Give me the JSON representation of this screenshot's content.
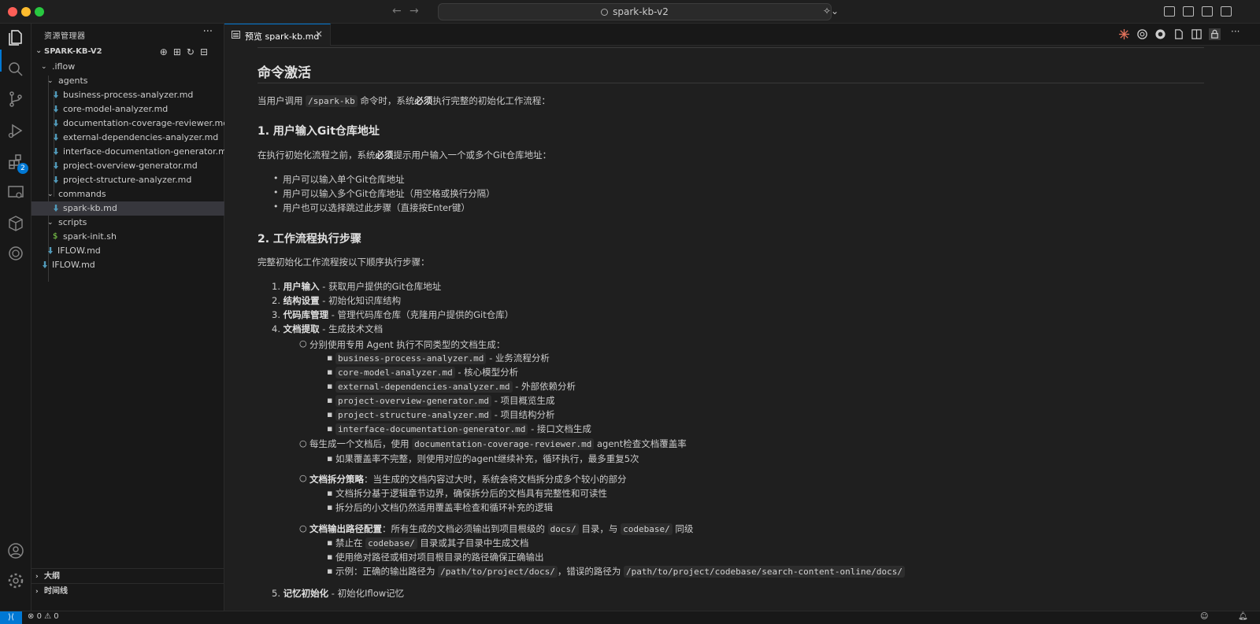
{
  "window": {
    "command_center": "spark-kb-v2"
  },
  "sidebar": {
    "title": "资源管理器",
    "root": "SPARK-KB-V2",
    "tree": [
      {
        "label": ".iflow",
        "type": "folder"
      },
      {
        "label": "agents",
        "type": "folder"
      },
      {
        "label": "business-process-analyzer.md",
        "type": "md"
      },
      {
        "label": "core-model-analyzer.md",
        "type": "md"
      },
      {
        "label": "documentation-coverage-reviewer.md",
        "type": "md"
      },
      {
        "label": "external-dependencies-analyzer.md",
        "type": "md"
      },
      {
        "label": "interface-documentation-generator.md",
        "type": "md"
      },
      {
        "label": "project-overview-generator.md",
        "type": "md"
      },
      {
        "label": "project-structure-analyzer.md",
        "type": "md"
      },
      {
        "label": "commands",
        "type": "folder"
      },
      {
        "label": "spark-kb.md",
        "type": "md",
        "selected": true
      },
      {
        "label": "scripts",
        "type": "folder"
      },
      {
        "label": "spark-init.sh",
        "type": "sh"
      },
      {
        "label": "IFLOW.md",
        "type": "md"
      },
      {
        "label": "IFLOW.md",
        "type": "md"
      }
    ],
    "sections": [
      "大纲",
      "时间线"
    ]
  },
  "activity": {
    "extensions_badge": "2"
  },
  "editor": {
    "tab_label": "预览 spark-kb.md",
    "doc": {
      "h_main": "命令激活",
      "intro_1": "当用户调用",
      "intro_code": "/spark-kb",
      "intro_2": "命令时，系统",
      "intro_b": "必须",
      "intro_3": "执行完整的初始化工作流程：",
      "s1_title": "1. 用户输入Git仓库地址",
      "s1_p_1": "在执行初始化流程之前，系统",
      "s1_p_b": "必须",
      "s1_p_2": "提示用户输入一个或多个Git仓库地址：",
      "s1_items": [
        "用户可以输入单个Git仓库地址",
        "用户可以输入多个Git仓库地址（用空格或换行分隔）",
        "用户也可以选择跳过此步骤（直接按Enter键）"
      ],
      "s2_title": "2. 工作流程执行步骤",
      "s2_p": "完整初始化工作流程按以下顺序执行步骤：",
      "steps": [
        {
          "num": "1.",
          "b": "用户输入",
          "rest": " - 获取用户提供的Git仓库地址"
        },
        {
          "num": "2.",
          "b": "结构设置",
          "rest": " - 初始化知识库结构"
        },
        {
          "num": "3.",
          "b": "代码库管理",
          "rest": " - 管理代码库仓库（克隆用户提供的Git仓库）"
        },
        {
          "num": "4.",
          "b": "文档提取",
          "rest": " - 生成技术文档"
        }
      ],
      "agents_intro": "分别使用专用 Agent 执行不同类型的文档生成：",
      "agents": [
        {
          "code": "business-process-analyzer.md",
          "desc": " - 业务流程分析"
        },
        {
          "code": "core-model-analyzer.md",
          "desc": " - 核心模型分析"
        },
        {
          "code": "external-dependencies-analyzer.md",
          "desc": " - 外部依赖分析"
        },
        {
          "code": "project-overview-generator.md",
          "desc": " - 项目概览生成"
        },
        {
          "code": "project-structure-analyzer.md",
          "desc": " - 项目结构分析"
        },
        {
          "code": "interface-documentation-generator.md",
          "desc": " - 接口文档生成"
        }
      ],
      "cov_1": "每生成一个文档后，使用",
      "cov_code": "documentation-coverage-reviewer.md",
      "cov_2": "agent检查文档覆盖率",
      "cov_sub": "如果覆盖率不完整，则使用对应的agent继续补充，循环执行，最多重复5次",
      "split_b": "文档拆分策略",
      "split_rest": "：当生成的文档内容过大时，系统会将文档拆分成多个较小的部分",
      "split_items": [
        "文档拆分基于逻辑章节边界，确保拆分后的文档具有完整性和可读性",
        "拆分后的小文档仍然适用覆盖率检查和循环补充的逻辑"
      ],
      "out_b": "文档输出路径配置",
      "out_1": "：所有生成的文档必须输出到项目根级的",
      "out_code1": "docs/",
      "out_2": "目录，与",
      "out_code2": "codebase/",
      "out_3": "同级",
      "out_i1_1": "禁止在",
      "out_i1_code": "codebase/",
      "out_i1_2": "目录或其子目录中生成文档",
      "out_i2": "使用绝对路径或相对项目根目录的路径确保正确输出",
      "out_i3_1": "示例：正确的输出路径为",
      "out_i3_code1": "/path/to/project/docs/",
      "out_i3_2": "，错误的路径为",
      "out_i3_code2": "/path/to/project/codebase/search-content-online/docs/",
      "step5_num": "5.",
      "step5_b": "记忆初始化",
      "step5_rest": " - 初始化Iflow记忆"
    }
  },
  "status": {
    "errors": "0",
    "warnings": "0"
  }
}
